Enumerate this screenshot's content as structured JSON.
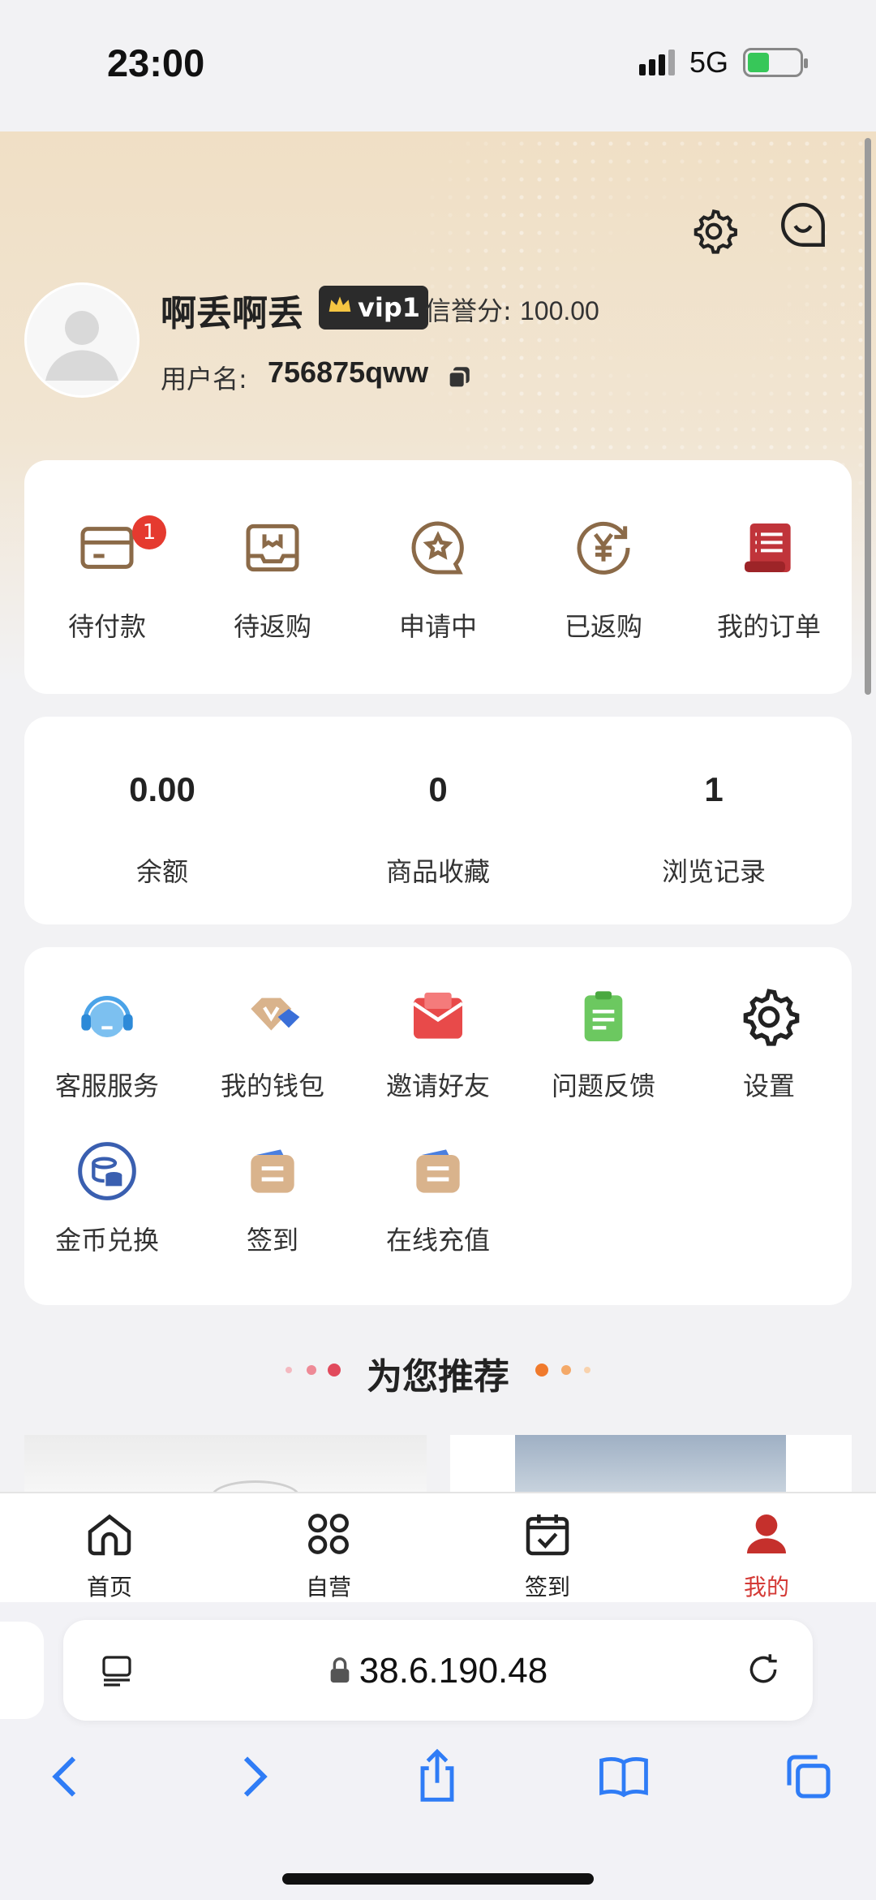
{
  "status_bar": {
    "time": "23:00",
    "network": "5G"
  },
  "profile": {
    "nickname": "啊丢啊丢",
    "vip": "vip1",
    "credit_label": "信誉分:",
    "credit_value": "100.00",
    "username_label": "用户名:",
    "username": "756875qww"
  },
  "orders": [
    {
      "label": "待付款",
      "icon": "card-icon",
      "badge": "1"
    },
    {
      "label": "待返购",
      "icon": "box-icon"
    },
    {
      "label": "申请中",
      "icon": "chat-star-icon"
    },
    {
      "label": "已返购",
      "icon": "yen-refresh-icon"
    },
    {
      "label": "我的订单",
      "icon": "scroll-icon"
    }
  ],
  "stats": [
    {
      "value": "0.00",
      "label": "余额"
    },
    {
      "value": "0",
      "label": "商品收藏"
    },
    {
      "value": "1",
      "label": "浏览记录"
    }
  ],
  "tools": [
    {
      "label": "客服服务",
      "icon": "headset-icon"
    },
    {
      "label": "我的钱包",
      "icon": "wallet-icon"
    },
    {
      "label": "邀请好友",
      "icon": "envelope-icon"
    },
    {
      "label": "问题反馈",
      "icon": "clipboard-icon"
    },
    {
      "label": "设置",
      "icon": "gear-icon"
    },
    {
      "label": "金币兑换",
      "icon": "coin-exchange-icon"
    },
    {
      "label": "签到",
      "icon": "ticket-icon"
    },
    {
      "label": "在线充值",
      "icon": "ticket-icon"
    }
  ],
  "recommend_title": "为您推荐",
  "tabs": [
    {
      "label": "首页",
      "icon": "home-icon"
    },
    {
      "label": "自营",
      "icon": "grid-icon"
    },
    {
      "label": "签到",
      "icon": "calendar-check-icon"
    },
    {
      "label": "我的",
      "icon": "user-icon",
      "active": true
    }
  ],
  "browser": {
    "url": "38.6.190.48"
  },
  "colors": {
    "accent": "#d43a36",
    "header": "#f0dfc5",
    "icon_brown": "#8b6a48"
  }
}
